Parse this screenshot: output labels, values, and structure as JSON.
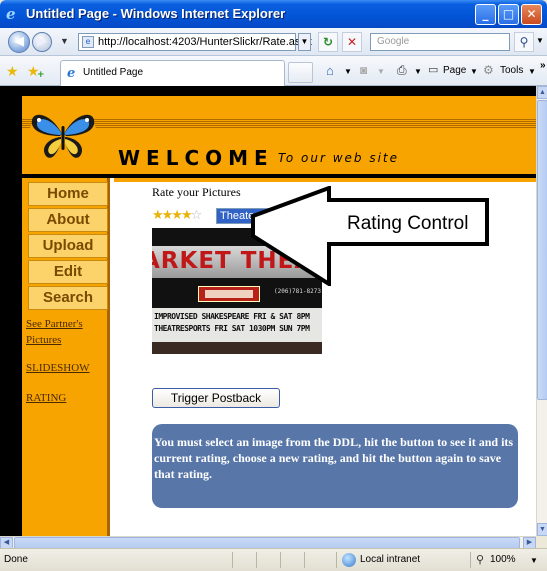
{
  "window": {
    "title": "Untitled Page - Windows Internet Explorer",
    "minimize_symbol": "_",
    "maximize_symbol": "□",
    "close_symbol": "✕"
  },
  "address_bar": {
    "url": "http://localhost:4203/HunterSlickr/Rate.aspx",
    "search_placeholder": "Google"
  },
  "tab_bar": {
    "tab_label": "Untitled Page",
    "page_menu": "Page",
    "tools_menu": "Tools"
  },
  "site": {
    "welcome": "WELCOME",
    "tagline": "To our web site",
    "nav_buttons": [
      "Home",
      "About",
      "Upload",
      "Edit",
      "Search"
    ],
    "nav_links": {
      "partner_line1": "See Partner's",
      "partner_line2": "Pictures",
      "slideshow": "SLIDESHOW",
      "rating": "RATING"
    }
  },
  "main": {
    "heading": "Rate your Pictures",
    "rating_stars_filled": 4,
    "rating_stars_total": 5,
    "stars_on": "★★★★",
    "stars_off": "☆",
    "ddl_value": "Theater",
    "callout_text": "Rating Control",
    "photo": {
      "marquee": "ARKET THEATER",
      "phone": "(206)781-8273",
      "board_line1": "IMPROVISED SHAKESPEARE FRI & SAT 8PM",
      "board_line2": "THEATRESPORTS FRI SAT 1030PM SUN 7PM"
    },
    "postback_button": "Trigger Postback",
    "info_text": "You must select an image from the DDL, hit the button to see it and its current rating, choose a new rating, and hit the button again to save that rating."
  },
  "status_bar": {
    "status": "Done",
    "zone": "Local intranet",
    "zoom": "100%"
  },
  "colors": {
    "site_orange": "#f8a400",
    "info_box": "#5877a8",
    "ddl_selected": "#3162c6"
  }
}
